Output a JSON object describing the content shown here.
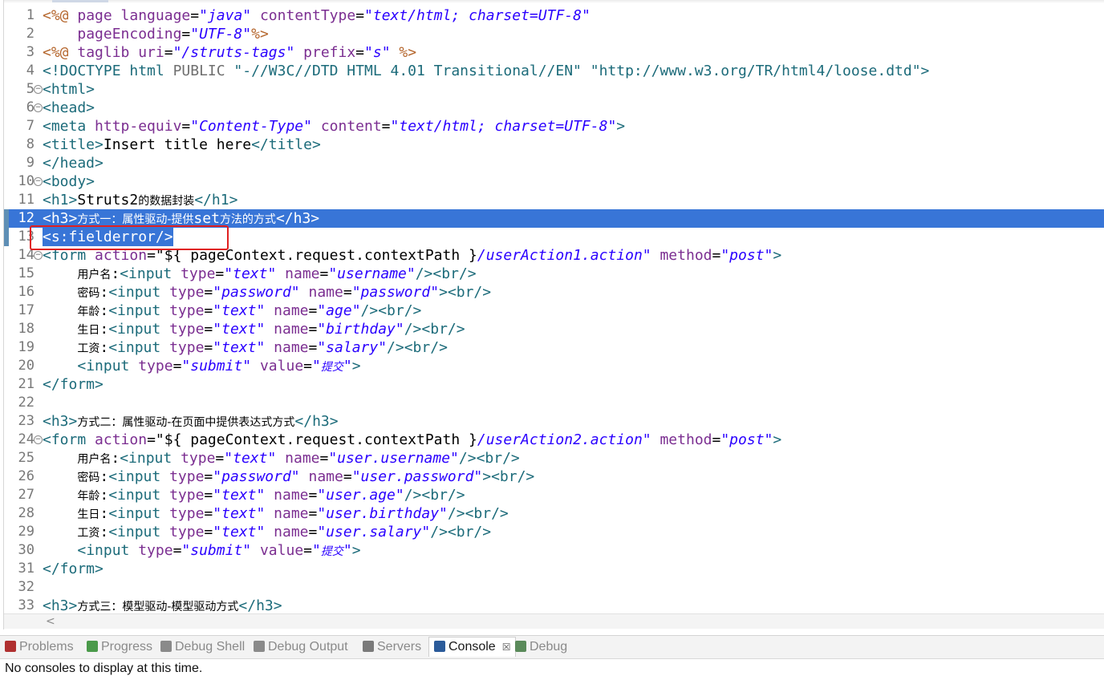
{
  "editor": {
    "lines": [
      {
        "n": "1",
        "fold": false,
        "tokens": [
          [
            "dir",
            "<%@ "
          ],
          [
            "attr",
            "page "
          ],
          [
            "attr",
            "language"
          ],
          [
            "blk",
            "="
          ],
          [
            "val",
            "\"java\""
          ],
          [
            "blk",
            " "
          ],
          [
            "attr",
            "contentType"
          ],
          [
            "blk",
            "="
          ],
          [
            "val",
            "\"text/html; charset=UTF-8\""
          ]
        ]
      },
      {
        "n": "2",
        "fold": false,
        "tokens": [
          [
            "blk",
            "    "
          ],
          [
            "attr",
            "pageEncoding"
          ],
          [
            "blk",
            "="
          ],
          [
            "val",
            "\"UTF-8\""
          ],
          [
            "dir",
            "%>"
          ]
        ]
      },
      {
        "n": "3",
        "fold": false,
        "tokens": [
          [
            "dir",
            "<%@ "
          ],
          [
            "attr",
            "taglib "
          ],
          [
            "attr",
            "uri"
          ],
          [
            "blk",
            "="
          ],
          [
            "val",
            "\"/struts-tags\""
          ],
          [
            "blk",
            " "
          ],
          [
            "attr",
            "prefix"
          ],
          [
            "blk",
            "="
          ],
          [
            "val",
            "\"s\""
          ],
          [
            "dir",
            " %>"
          ]
        ]
      },
      {
        "n": "4",
        "fold": false,
        "tokens": [
          [
            "tag",
            "<!DOCTYPE "
          ],
          [
            "tag",
            "html "
          ],
          [
            "gray",
            "PUBLIC "
          ],
          [
            "tag",
            "\"-//W3C//DTD HTML 4.01 Transitional//EN\" \"http://www.w3.org/TR/html4/loose.dtd\">"
          ]
        ]
      },
      {
        "n": "5",
        "fold": true,
        "tokens": [
          [
            "tag",
            "<html>"
          ]
        ]
      },
      {
        "n": "6",
        "fold": true,
        "tokens": [
          [
            "tag",
            "<head>"
          ]
        ]
      },
      {
        "n": "7",
        "fold": false,
        "tokens": [
          [
            "tag",
            "<meta "
          ],
          [
            "attr",
            "http-equiv"
          ],
          [
            "blk",
            "="
          ],
          [
            "val",
            "\"Content-Type\""
          ],
          [
            "blk",
            " "
          ],
          [
            "attr",
            "content"
          ],
          [
            "blk",
            "="
          ],
          [
            "val",
            "\"text/html; charset=UTF-8\""
          ],
          [
            "tag",
            ">"
          ]
        ]
      },
      {
        "n": "8",
        "fold": false,
        "tokens": [
          [
            "tag",
            "<title>"
          ],
          [
            "blk",
            "Insert title here"
          ],
          [
            "tag",
            "</title>"
          ]
        ]
      },
      {
        "n": "9",
        "fold": false,
        "tokens": [
          [
            "tag",
            "</head>"
          ]
        ]
      },
      {
        "n": "10",
        "fold": true,
        "tokens": [
          [
            "tag",
            "<body>"
          ]
        ]
      },
      {
        "n": "11",
        "fold": false,
        "tokens": [
          [
            "tag",
            "<h1>"
          ],
          [
            "blk",
            "Struts2"
          ],
          [
            "cn",
            "的数据封装"
          ],
          [
            "tag",
            "</h1>"
          ]
        ]
      },
      {
        "n": "12",
        "fold": false,
        "selected": "full",
        "tokens": [
          [
            "tag",
            "<h3>"
          ],
          [
            "cn",
            "方式一：属性驱动-提供"
          ],
          [
            "blk",
            "set"
          ],
          [
            "cn",
            "方法的方式"
          ],
          [
            "tag",
            "</h3>"
          ]
        ]
      },
      {
        "n": "13",
        "fold": false,
        "selected": "text",
        "tokens": [
          [
            "tag",
            "<s:fielderror/>"
          ]
        ]
      },
      {
        "n": "14",
        "fold": true,
        "tokens": [
          [
            "tag",
            "<form "
          ],
          [
            "attr",
            "action"
          ],
          [
            "blk",
            "=\"${ pageContext.request.contextPath }"
          ],
          [
            "val",
            "/userAction1.action\""
          ],
          [
            "blk",
            " "
          ],
          [
            "attr",
            "method"
          ],
          [
            "blk",
            "="
          ],
          [
            "val",
            "\"post\""
          ],
          [
            "tag",
            ">"
          ]
        ]
      },
      {
        "n": "15",
        "fold": false,
        "tokens": [
          [
            "blk",
            "    "
          ],
          [
            "cn",
            "用户名"
          ],
          [
            "blk",
            ":"
          ],
          [
            "tag",
            "<input "
          ],
          [
            "attr",
            "type"
          ],
          [
            "blk",
            "="
          ],
          [
            "val",
            "\"text\""
          ],
          [
            "blk",
            " "
          ],
          [
            "attr",
            "name"
          ],
          [
            "blk",
            "="
          ],
          [
            "val",
            "\"username\""
          ],
          [
            "tag",
            "/><br/>"
          ]
        ]
      },
      {
        "n": "16",
        "fold": false,
        "tokens": [
          [
            "blk",
            "    "
          ],
          [
            "cn",
            "密码"
          ],
          [
            "blk",
            ":"
          ],
          [
            "tag",
            "<input "
          ],
          [
            "attr",
            "type"
          ],
          [
            "blk",
            "="
          ],
          [
            "val",
            "\"password\""
          ],
          [
            "blk",
            " "
          ],
          [
            "attr",
            "name"
          ],
          [
            "blk",
            "="
          ],
          [
            "val",
            "\"password\""
          ],
          [
            "tag",
            "><br/>"
          ]
        ]
      },
      {
        "n": "17",
        "fold": false,
        "tokens": [
          [
            "blk",
            "    "
          ],
          [
            "cn",
            "年龄"
          ],
          [
            "blk",
            ":"
          ],
          [
            "tag",
            "<input "
          ],
          [
            "attr",
            "type"
          ],
          [
            "blk",
            "="
          ],
          [
            "val",
            "\"text\""
          ],
          [
            "blk",
            " "
          ],
          [
            "attr",
            "name"
          ],
          [
            "blk",
            "="
          ],
          [
            "val",
            "\"age\""
          ],
          [
            "tag",
            "/><br/>"
          ]
        ]
      },
      {
        "n": "18",
        "fold": false,
        "tokens": [
          [
            "blk",
            "    "
          ],
          [
            "cn",
            "生日"
          ],
          [
            "blk",
            ":"
          ],
          [
            "tag",
            "<input "
          ],
          [
            "attr",
            "type"
          ],
          [
            "blk",
            "="
          ],
          [
            "val",
            "\"text\""
          ],
          [
            "blk",
            " "
          ],
          [
            "attr",
            "name"
          ],
          [
            "blk",
            "="
          ],
          [
            "val",
            "\"birthday\""
          ],
          [
            "tag",
            "/><br/>"
          ]
        ]
      },
      {
        "n": "19",
        "fold": false,
        "tokens": [
          [
            "blk",
            "    "
          ],
          [
            "cn",
            "工资"
          ],
          [
            "blk",
            ":"
          ],
          [
            "tag",
            "<input "
          ],
          [
            "attr",
            "type"
          ],
          [
            "blk",
            "="
          ],
          [
            "val",
            "\"text\""
          ],
          [
            "blk",
            " "
          ],
          [
            "attr",
            "name"
          ],
          [
            "blk",
            "="
          ],
          [
            "val",
            "\"salary\""
          ],
          [
            "tag",
            "/><br/>"
          ]
        ]
      },
      {
        "n": "20",
        "fold": false,
        "tokens": [
          [
            "blk",
            "    "
          ],
          [
            "tag",
            "<input "
          ],
          [
            "attr",
            "type"
          ],
          [
            "blk",
            "="
          ],
          [
            "val",
            "\"submit\""
          ],
          [
            "blk",
            " "
          ],
          [
            "attr",
            "value"
          ],
          [
            "blk",
            "="
          ],
          [
            "val",
            "\""
          ],
          [
            "cnit",
            "提交"
          ],
          [
            "val",
            "\""
          ],
          [
            "tag",
            ">"
          ]
        ]
      },
      {
        "n": "21",
        "fold": false,
        "tokens": [
          [
            "tag",
            "</form>"
          ]
        ]
      },
      {
        "n": "22",
        "fold": false,
        "tokens": []
      },
      {
        "n": "23",
        "fold": false,
        "tokens": [
          [
            "tag",
            "<h3>"
          ],
          [
            "cn",
            "方式二：属性驱动-在页面中提供表达式方式"
          ],
          [
            "tag",
            "</h3>"
          ]
        ]
      },
      {
        "n": "24",
        "fold": true,
        "tokens": [
          [
            "tag",
            "<form "
          ],
          [
            "attr",
            "action"
          ],
          [
            "blk",
            "=\"${ pageContext.request.contextPath }"
          ],
          [
            "val",
            "/userAction2.action\""
          ],
          [
            "blk",
            " "
          ],
          [
            "attr",
            "method"
          ],
          [
            "blk",
            "="
          ],
          [
            "val",
            "\"post\""
          ],
          [
            "tag",
            ">"
          ]
        ]
      },
      {
        "n": "25",
        "fold": false,
        "tokens": [
          [
            "blk",
            "    "
          ],
          [
            "cn",
            "用户名"
          ],
          [
            "blk",
            ":"
          ],
          [
            "tag",
            "<input "
          ],
          [
            "attr",
            "type"
          ],
          [
            "blk",
            "="
          ],
          [
            "val",
            "\"text\""
          ],
          [
            "blk",
            " "
          ],
          [
            "attr",
            "name"
          ],
          [
            "blk",
            "="
          ],
          [
            "val",
            "\"user.username\""
          ],
          [
            "tag",
            "/><br/>"
          ]
        ]
      },
      {
        "n": "26",
        "fold": false,
        "tokens": [
          [
            "blk",
            "    "
          ],
          [
            "cn",
            "密码"
          ],
          [
            "blk",
            ":"
          ],
          [
            "tag",
            "<input "
          ],
          [
            "attr",
            "type"
          ],
          [
            "blk",
            "="
          ],
          [
            "val",
            "\"password\""
          ],
          [
            "blk",
            " "
          ],
          [
            "attr",
            "name"
          ],
          [
            "blk",
            "="
          ],
          [
            "val",
            "\"user.password\""
          ],
          [
            "tag",
            "><br/>"
          ]
        ]
      },
      {
        "n": "27",
        "fold": false,
        "tokens": [
          [
            "blk",
            "    "
          ],
          [
            "cn",
            "年龄"
          ],
          [
            "blk",
            ":"
          ],
          [
            "tag",
            "<input "
          ],
          [
            "attr",
            "type"
          ],
          [
            "blk",
            "="
          ],
          [
            "val",
            "\"text\""
          ],
          [
            "blk",
            " "
          ],
          [
            "attr",
            "name"
          ],
          [
            "blk",
            "="
          ],
          [
            "val",
            "\"user.age\""
          ],
          [
            "tag",
            "/><br/>"
          ]
        ]
      },
      {
        "n": "28",
        "fold": false,
        "tokens": [
          [
            "blk",
            "    "
          ],
          [
            "cn",
            "生日"
          ],
          [
            "blk",
            ":"
          ],
          [
            "tag",
            "<input "
          ],
          [
            "attr",
            "type"
          ],
          [
            "blk",
            "="
          ],
          [
            "val",
            "\"text\""
          ],
          [
            "blk",
            " "
          ],
          [
            "attr",
            "name"
          ],
          [
            "blk",
            "="
          ],
          [
            "val",
            "\"user.birthday\""
          ],
          [
            "tag",
            "/><br/>"
          ]
        ]
      },
      {
        "n": "29",
        "fold": false,
        "tokens": [
          [
            "blk",
            "    "
          ],
          [
            "cn",
            "工资"
          ],
          [
            "blk",
            ":"
          ],
          [
            "tag",
            "<input "
          ],
          [
            "attr",
            "type"
          ],
          [
            "blk",
            "="
          ],
          [
            "val",
            "\"text\""
          ],
          [
            "blk",
            " "
          ],
          [
            "attr",
            "name"
          ],
          [
            "blk",
            "="
          ],
          [
            "val",
            "\"user.salary\""
          ],
          [
            "tag",
            "/><br/>"
          ]
        ]
      },
      {
        "n": "30",
        "fold": false,
        "tokens": [
          [
            "blk",
            "    "
          ],
          [
            "tag",
            "<input "
          ],
          [
            "attr",
            "type"
          ],
          [
            "blk",
            "="
          ],
          [
            "val",
            "\"submit\""
          ],
          [
            "blk",
            " "
          ],
          [
            "attr",
            "value"
          ],
          [
            "blk",
            "="
          ],
          [
            "val",
            "\""
          ],
          [
            "cnit",
            "提交"
          ],
          [
            "val",
            "\""
          ],
          [
            "tag",
            ">"
          ]
        ]
      },
      {
        "n": "31",
        "fold": false,
        "tokens": [
          [
            "tag",
            "</form>"
          ]
        ]
      },
      {
        "n": "32",
        "fold": false,
        "tokens": []
      },
      {
        "n": "33",
        "fold": false,
        "tokens": [
          [
            "tag",
            "<h3>"
          ],
          [
            "cn",
            "方式三：模型驱动-模型驱动方式"
          ],
          [
            "tag",
            "</h3>"
          ]
        ]
      }
    ],
    "scroll_left_arrow": "<"
  },
  "bottom_panel": {
    "tabs": [
      {
        "label": "Problems",
        "icon": "problems-icon",
        "color": "#b03030",
        "active": false
      },
      {
        "label": "Progress",
        "icon": "progress-icon",
        "color": "#4a9a4a",
        "active": false
      },
      {
        "label": "Debug Shell",
        "icon": "debug-shell-icon",
        "color": "#8a8a8a",
        "active": false
      },
      {
        "label": "Debug Output",
        "icon": "debug-output-icon",
        "color": "#8a8a8a",
        "active": false
      },
      {
        "label": "Servers",
        "icon": "servers-icon",
        "color": "#7a7a7a",
        "active": false
      },
      {
        "label": "Console",
        "icon": "console-icon",
        "color": "#2b5b9a",
        "active": true
      },
      {
        "label": "Debug",
        "icon": "debug-icon",
        "color": "#5a8a5a",
        "active": false
      }
    ],
    "close_glyph": "☒",
    "console_message": "No consoles to display at this time."
  }
}
